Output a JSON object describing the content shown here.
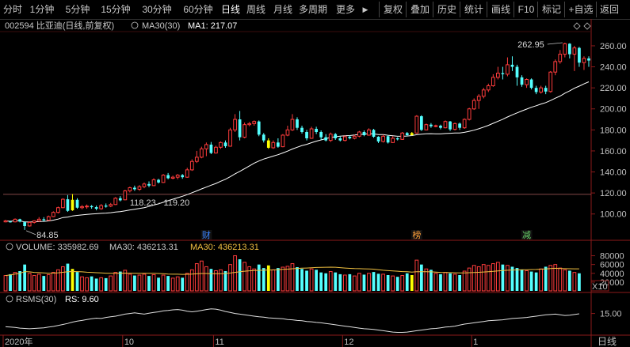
{
  "toolbar": {
    "left_tabs": [
      "分时",
      "1分钟",
      "5分钟",
      "15分钟",
      "30分钟",
      "60分钟",
      "日线",
      "周线",
      "月线",
      "多周期",
      "更多"
    ],
    "active_tab": "日线",
    "more_arrow": "▶",
    "right_buttons": [
      "复权",
      "叠加",
      "历史",
      "统计",
      "画线",
      "F10",
      "标记",
      "+自选",
      "返回"
    ]
  },
  "main_panel": {
    "title": "002594 比亚迪(日线,前复权)",
    "indicator_label": "MA30(30)",
    "ma_value_label": "MA1: 217.07",
    "annotation_high": "262.95",
    "annotation_low": "84.85",
    "annotation_mid": "118.23 - 119.20",
    "event_markers": [
      {
        "label": "财",
        "color": "#3b83ff",
        "at_candle": 42
      },
      {
        "label": "榜",
        "color": "#ff9f3a",
        "at_candle": 86
      },
      {
        "label": "减",
        "color": "#6bd36b",
        "at_candle": 109
      }
    ],
    "colors": {
      "up": "#ff3c3c",
      "down": "#54ffff",
      "highlight": "#ffff00",
      "ma_line": "#ffffff"
    }
  },
  "volume_panel": {
    "label": "VOLUME: 335982.69",
    "ma30_label": "MA30: 436213.31",
    "ma30_label2": "MA30: 436213.31",
    "y_labels": [
      "80000",
      "60000",
      "40000",
      "20000"
    ],
    "unit_label": "X10"
  },
  "rsms_panel": {
    "label": "RSMS(30)",
    "rs_label": "RS: 9.60",
    "y_label": "15.00"
  },
  "x_axis": {
    "labels": [
      {
        "text": "2020年",
        "at_candle": 0
      },
      {
        "text": "10",
        "at_candle": 25
      },
      {
        "text": "11",
        "at_candle": 44
      },
      {
        "text": "12",
        "at_candle": 71
      },
      {
        "text": "1",
        "at_candle": 98
      }
    ],
    "period_label": "日线"
  },
  "chart_data": {
    "type": "candlestick",
    "title": "002594 比亚迪(日线,前复权)",
    "ylim": [
      84,
      272
    ],
    "yticks": [
      100,
      120,
      140,
      160,
      180,
      200,
      220,
      240,
      260
    ],
    "ma30_last": 217.07,
    "highest": 262.95,
    "lowest": 84.85,
    "candles": [
      [
        92.5,
        93.5,
        92.0,
        94.5
      ],
      [
        92.8,
        92.5,
        91.8,
        93.6
      ],
      [
        92.5,
        95.0,
        92.0,
        95.8
      ],
      [
        95.0,
        92.8,
        92.0,
        95.5
      ],
      [
        92.2,
        88.5,
        84.85,
        93.0
      ],
      [
        88.6,
        92.0,
        88.0,
        93.0
      ],
      [
        92.0,
        93.5,
        91.0,
        94.0
      ],
      [
        93.5,
        95.0,
        92.5,
        97.0
      ],
      [
        95.0,
        94.0,
        93.0,
        97.0
      ],
      [
        94.0,
        97.5,
        93.5,
        98.5
      ],
      [
        97.5,
        101.5,
        97.0,
        102.5
      ],
      [
        101.5,
        106.0,
        100.5,
        107.0
      ],
      [
        106.0,
        114.0,
        105.5,
        115.0
      ],
      [
        114.0,
        103.0,
        102.0,
        118.0
      ],
      [
        103.5,
        113.5,
        103.0,
        119.0
      ],
      [
        113.5,
        106.0,
        105.0,
        115.0
      ],
      [
        106.0,
        107.0,
        104.5,
        108.5
      ],
      [
        107.0,
        107.5,
        105.0,
        109.0
      ],
      [
        107.5,
        106.5,
        105.0,
        108.5
      ],
      [
        106.5,
        105.0,
        103.5,
        108.0
      ],
      [
        105.0,
        108.0,
        104.0,
        109.5
      ],
      [
        108.0,
        107.0,
        106.0,
        110.0
      ],
      [
        107.5,
        109.0,
        106.5,
        110.5
      ],
      [
        109.0,
        115.0,
        108.5,
        116.0
      ],
      [
        115.0,
        113.0,
        112.0,
        117.0
      ],
      [
        113.5,
        122.0,
        113.0,
        123.0
      ],
      [
        122.0,
        125.0,
        120.5,
        126.0
      ],
      [
        125.0,
        123.5,
        122.0,
        127.0
      ],
      [
        123.5,
        126.0,
        122.0,
        127.5
      ],
      [
        126.0,
        128.5,
        124.5,
        130.0
      ],
      [
        128.5,
        127.0,
        125.5,
        131.0
      ],
      [
        127.0,
        132.5,
        126.5,
        134.0
      ],
      [
        132.5,
        130.0,
        129.0,
        133.5
      ],
      [
        130.0,
        137.0,
        129.5,
        138.0
      ],
      [
        137.0,
        134.0,
        133.0,
        139.0
      ],
      [
        134.0,
        135.0,
        133.0,
        136.5
      ],
      [
        135.0,
        137.0,
        133.0,
        138.0
      ],
      [
        137.0,
        135.0,
        133.5,
        138.0
      ],
      [
        135.0,
        142.0,
        134.5,
        144.0
      ],
      [
        142.0,
        150.0,
        141.0,
        152.0
      ],
      [
        150.0,
        154.0,
        148.5,
        160.0
      ],
      [
        154.0,
        162.0,
        153.0,
        164.0
      ],
      [
        162.0,
        166.0,
        155.0,
        168.0
      ],
      [
        166.0,
        158.0,
        157.0,
        168.5
      ],
      [
        158.0,
        163.5,
        157.5,
        165.0
      ],
      [
        163.5,
        168.0,
        162.0,
        169.0
      ],
      [
        168.0,
        164.5,
        163.0,
        170.0
      ],
      [
        164.5,
        180.0,
        164.0,
        182.0
      ],
      [
        180.0,
        190.0,
        178.0,
        195.0
      ],
      [
        190.0,
        173.0,
        170.0,
        198.0
      ],
      [
        173.0,
        185.0,
        172.0,
        187.0
      ],
      [
        185.0,
        186.0,
        183.5,
        187.5
      ],
      [
        186.0,
        188.0,
        184.0,
        189.0
      ],
      [
        188.0,
        175.5,
        174.0,
        189.0
      ],
      [
        175.5,
        170.0,
        168.0,
        177.0
      ],
      [
        170.0,
        163.0,
        162.0,
        172.0
      ],
      [
        163.0,
        168.0,
        162.0,
        170.0
      ],
      [
        168.0,
        164.0,
        163.0,
        172.0
      ],
      [
        164.0,
        175.0,
        163.5,
        176.0
      ],
      [
        175.0,
        180.0,
        174.0,
        184.0
      ],
      [
        180.0,
        190.0,
        179.0,
        195.0
      ],
      [
        190.0,
        182.0,
        180.0,
        192.0
      ],
      [
        182.0,
        178.0,
        176.5,
        184.0
      ],
      [
        178.0,
        172.0,
        170.0,
        180.0
      ],
      [
        172.0,
        181.0,
        171.5,
        183.0
      ],
      [
        181.0,
        178.0,
        176.0,
        183.0
      ],
      [
        178.0,
        173.0,
        170.5,
        179.5
      ],
      [
        173.0,
        170.0,
        169.0,
        176.0
      ],
      [
        170.0,
        176.0,
        168.5,
        177.5
      ],
      [
        176.0,
        172.0,
        170.5,
        177.0
      ],
      [
        172.0,
        170.0,
        169.0,
        174.0
      ],
      [
        170.0,
        173.5,
        169.0,
        175.0
      ],
      [
        173.5,
        172.0,
        171.0,
        175.0
      ],
      [
        172.0,
        174.0,
        171.0,
        175.5
      ],
      [
        174.0,
        178.0,
        173.0,
        179.0
      ],
      [
        178.0,
        175.0,
        174.0,
        179.5
      ],
      [
        175.0,
        180.0,
        174.5,
        181.5
      ],
      [
        180.0,
        173.5,
        172.5,
        181.0
      ],
      [
        173.5,
        169.0,
        167.5,
        174.0
      ],
      [
        169.0,
        174.0,
        168.0,
        175.5
      ],
      [
        174.0,
        168.0,
        167.0,
        175.0
      ],
      [
        168.0,
        172.0,
        167.5,
        174.0
      ],
      [
        172.0,
        171.0,
        170.0,
        173.0
      ],
      [
        171.0,
        177.0,
        170.5,
        178.0
      ],
      [
        177.0,
        175.0,
        174.0,
        178.0
      ],
      [
        175.0,
        177.0,
        174.5,
        178.0
      ],
      [
        177.0,
        193.0,
        176.5,
        194.0
      ],
      [
        193.0,
        180.0,
        179.0,
        194.0
      ],
      [
        180.0,
        185.0,
        179.5,
        186.0
      ],
      [
        185.0,
        183.5,
        182.0,
        186.5
      ],
      [
        183.5,
        184.0,
        182.5,
        185.0
      ],
      [
        184.0,
        182.0,
        180.5,
        185.0
      ],
      [
        182.0,
        188.0,
        181.5,
        189.0
      ],
      [
        188.0,
        180.5,
        179.0,
        188.5
      ],
      [
        180.5,
        186.0,
        179.5,
        187.0
      ],
      [
        186.0,
        182.0,
        180.0,
        187.0
      ],
      [
        182.0,
        190.0,
        181.0,
        191.0
      ],
      [
        190.0,
        200.0,
        189.0,
        201.0
      ],
      [
        200.0,
        208.0,
        199.0,
        210.0
      ],
      [
        208.0,
        212.0,
        200.0,
        214.0
      ],
      [
        212.0,
        218.0,
        210.0,
        220.0
      ],
      [
        218.0,
        222.0,
        216.0,
        224.0
      ],
      [
        222.0,
        230.0,
        221.0,
        233.0
      ],
      [
        230.0,
        234.0,
        228.0,
        240.0
      ],
      [
        234.0,
        233.0,
        228.0,
        240.0
      ],
      [
        233.0,
        242.0,
        231.0,
        249.0
      ],
      [
        242.0,
        240.0,
        236.0,
        250.0
      ],
      [
        240.0,
        230.0,
        222.0,
        242.0
      ],
      [
        230.0,
        223.0,
        221.0,
        232.0
      ],
      [
        223.0,
        228.0,
        220.0,
        229.0
      ],
      [
        228.0,
        220.0,
        218.5,
        229.0
      ],
      [
        220.0,
        216.0,
        214.0,
        222.0
      ],
      [
        216.0,
        220.0,
        214.5,
        222.0
      ],
      [
        220.0,
        216.5,
        214.0,
        222.0
      ],
      [
        216.5,
        235.0,
        215.5,
        236.0
      ],
      [
        235.0,
        245.0,
        232.0,
        247.0
      ],
      [
        245.0,
        252.0,
        243.0,
        256.0
      ],
      [
        252.0,
        262.0,
        249.0,
        262.95
      ],
      [
        262.0,
        252.0,
        248.0,
        262.5
      ],
      [
        252.0,
        258.0,
        236.0,
        260.0
      ],
      [
        258.0,
        244.0,
        240.0,
        259.0
      ],
      [
        244.0,
        248.0,
        237.0,
        250.0
      ],
      [
        248.0,
        246.0,
        240.0,
        250.0
      ]
    ],
    "highlight_candles": [
      14,
      55,
      85
    ],
    "volume_ylim": [
      0,
      90000
    ],
    "volume": [
      35000,
      38000,
      42000,
      45000,
      60000,
      40000,
      35000,
      38000,
      34000,
      37000,
      42000,
      48000,
      55000,
      62000,
      50000,
      43000,
      32000,
      30000,
      33000,
      28000,
      30000,
      29000,
      34000,
      42000,
      44000,
      47000,
      38000,
      35000,
      36000,
      38000,
      34000,
      37000,
      30000,
      36000,
      34000,
      29000,
      32000,
      30000,
      40000,
      48000,
      62000,
      68000,
      55000,
      50000,
      46000,
      48000,
      45000,
      60000,
      80000,
      72000,
      65000,
      55000,
      50000,
      60000,
      52000,
      58000,
      48000,
      52000,
      54000,
      56000,
      62000,
      54000,
      50000,
      46000,
      50000,
      48000,
      42000,
      40000,
      44000,
      42000,
      38000,
      36000,
      38000,
      34000,
      40000,
      37000,
      40000,
      43000,
      39000,
      38000,
      36000,
      34000,
      32000,
      35000,
      40000,
      36000,
      70000,
      60000,
      50000,
      48000,
      40000,
      38000,
      42000,
      40000,
      38000,
      36000,
      45000,
      52000,
      58000,
      55000,
      60000,
      58000,
      62000,
      65000,
      60000,
      58000,
      55000,
      52000,
      48000,
      46000,
      44000,
      42000,
      50000,
      55000,
      58000,
      60000,
      52000,
      48000,
      46000,
      42000,
      40000
    ],
    "rs_line": [
      11.0,
      10.9,
      10.8,
      10.6,
      10.5,
      10.4,
      10.5,
      10.6,
      10.7,
      10.9,
      11.1,
      11.4,
      11.7,
      12.0,
      12.4,
      12.7,
      12.9,
      13.2,
      13.4,
      13.6,
      13.5,
      13.8,
      14.0,
      14.2,
      14.5,
      14.8,
      15.0,
      15.2,
      15.0,
      14.8,
      15.1,
      15.3,
      15.5,
      15.8,
      15.9,
      16.1,
      16.2,
      16.0,
      15.7,
      15.5,
      15.7,
      15.9,
      16.2,
      16.4,
      16.3,
      16.0,
      15.6,
      15.3,
      15.0,
      14.8,
      14.6,
      14.4,
      14.2,
      14.0,
      13.9,
      13.7,
      13.6,
      13.5,
      13.4,
      13.2,
      13.1,
      12.9,
      12.8,
      12.6,
      12.5,
      12.3,
      12.2,
      12.0,
      11.8,
      11.6,
      11.4,
      11.2,
      11.0,
      10.8,
      10.6,
      10.4,
      10.3,
      10.2,
      10.0,
      9.8,
      9.6,
      9.4,
      9.3,
      9.3,
      9.4,
      9.6,
      9.8,
      10.0,
      10.2,
      10.4,
      10.5,
      10.7,
      10.9,
      11.0,
      11.2,
      11.5,
      11.8,
      12.0,
      12.2,
      12.4,
      12.6,
      12.8,
      12.9,
      13.0,
      13.1,
      13.3,
      13.5,
      13.6,
      13.7,
      13.8,
      14.0,
      14.2,
      14.4,
      14.6,
      14.7,
      14.8,
      14.6,
      14.4,
      14.5,
      14.7,
      14.9
    ],
    "rs_ylim": [
      8,
      18
    ]
  }
}
